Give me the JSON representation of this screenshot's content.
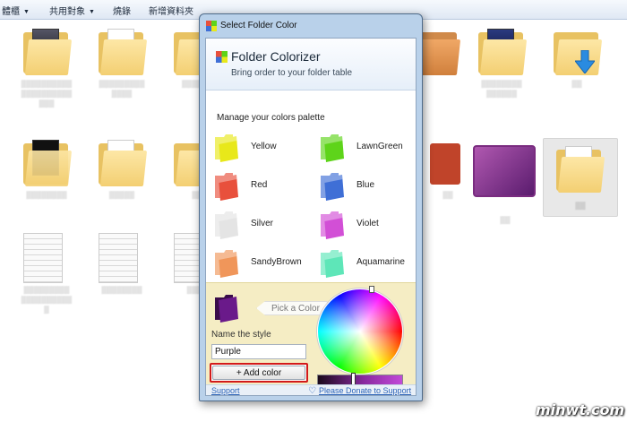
{
  "toolbar": {
    "organize": "體櫃",
    "share": "共用對象",
    "burn": "燒錄",
    "new_folder": "新增資料夾"
  },
  "dialog": {
    "title": "Select Folder Color",
    "app_name": "Folder Colorizer",
    "tagline": "Bring order to your folder table",
    "palette_heading": "Manage your colors palette",
    "colors": [
      {
        "label": "Yellow",
        "color": "#e8e81a"
      },
      {
        "label": "LawnGreen",
        "color": "#5ed41a"
      },
      {
        "label": "Red",
        "color": "#e8503c"
      },
      {
        "label": "Blue",
        "color": "#3f6fd6"
      },
      {
        "label": "Silver",
        "color": "#e4e4e4"
      },
      {
        "label": "Violet",
        "color": "#d24fd6"
      },
      {
        "label": "SandyBrown",
        "color": "#f0965a"
      },
      {
        "label": "Aquamarine",
        "color": "#5ee6b8"
      }
    ],
    "pick_hint": "Pick a Color",
    "style_label": "Name the style",
    "style_value": "Purple",
    "preview_color": "#6a1a8a",
    "add_button": "+ Add color",
    "support_link": "Support",
    "donate_link": "Please Donate to Support"
  },
  "watermark": "minwt.com"
}
